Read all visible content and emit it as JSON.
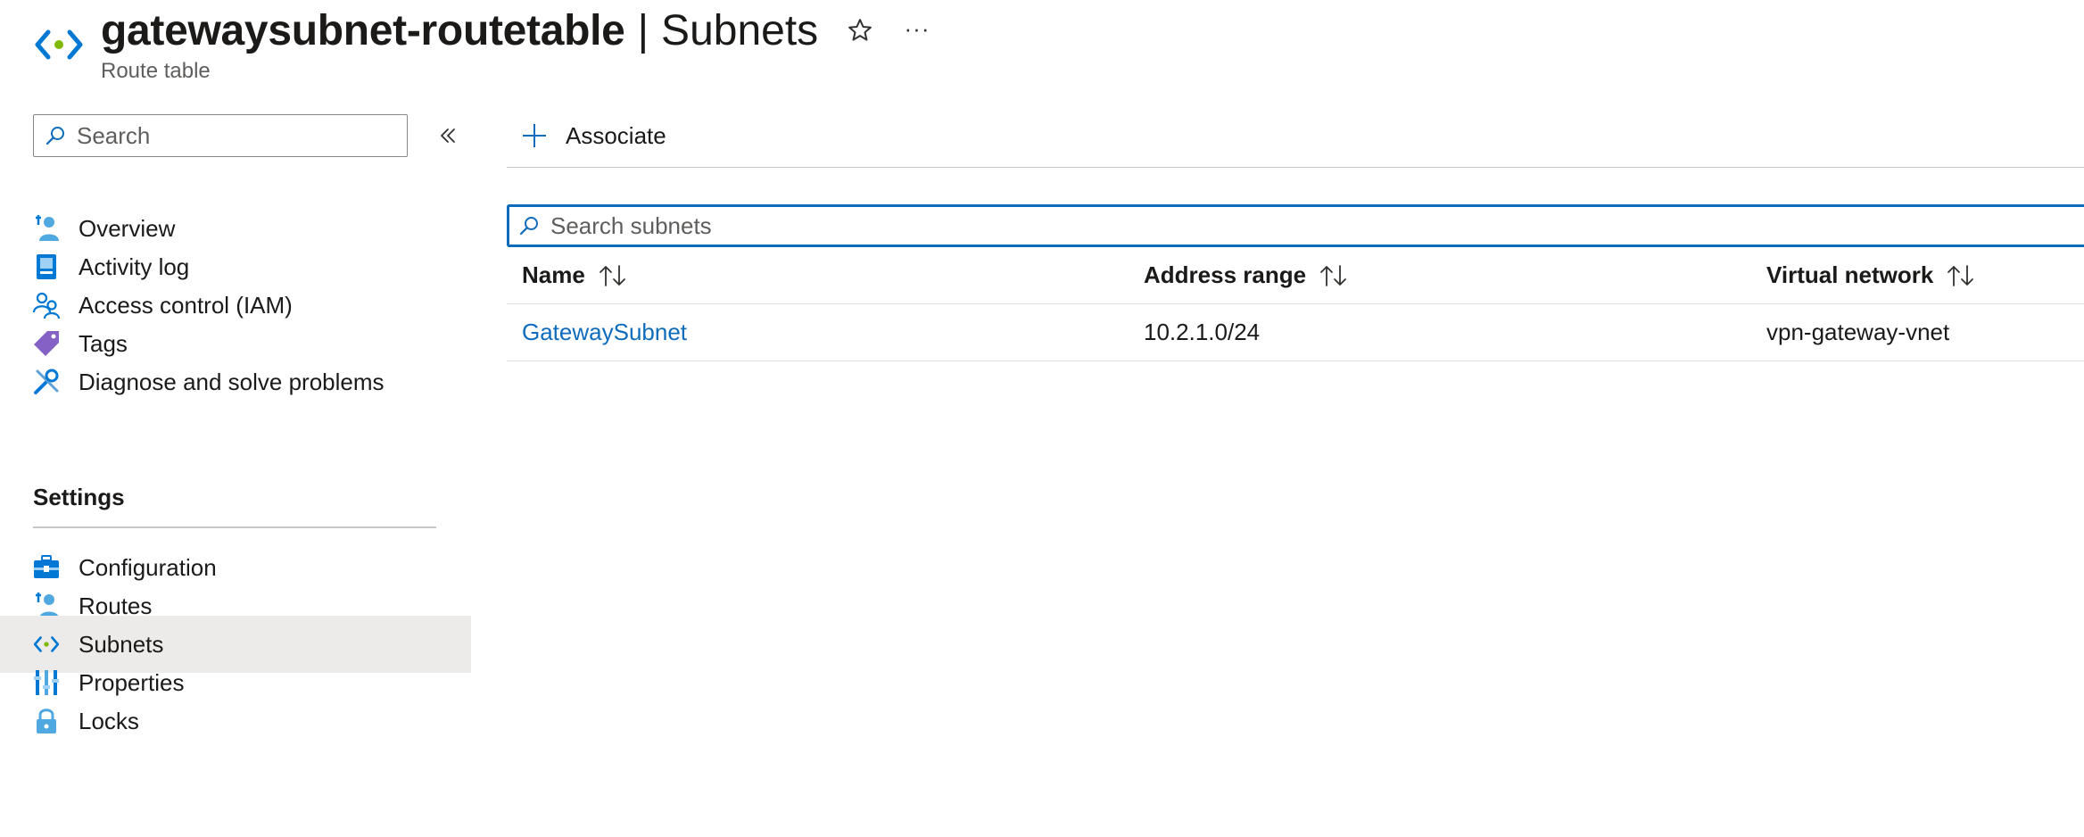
{
  "header": {
    "resource_name": "gatewaysubnet-routetable",
    "separator": "|",
    "page_name": "Subnets",
    "subtitle": "Route table",
    "more_label": "···"
  },
  "sidebar": {
    "search_placeholder": "Search",
    "items": [
      {
        "label": "Overview",
        "icon": "overview-icon"
      },
      {
        "label": "Activity log",
        "icon": "activity-log-icon"
      },
      {
        "label": "Access control (IAM)",
        "icon": "iam-icon"
      },
      {
        "label": "Tags",
        "icon": "tag-icon"
      },
      {
        "label": "Diagnose and solve problems",
        "icon": "wrench-icon"
      }
    ],
    "settings_header": "Settings",
    "settings_items": [
      {
        "label": "Configuration",
        "icon": "configuration-icon"
      },
      {
        "label": "Routes",
        "icon": "routes-icon"
      },
      {
        "label": "Subnets",
        "icon": "subnets-icon",
        "selected": true
      },
      {
        "label": "Properties",
        "icon": "properties-icon"
      },
      {
        "label": "Locks",
        "icon": "lock-icon"
      }
    ]
  },
  "toolbar": {
    "associate_label": "Associate"
  },
  "grid": {
    "search_placeholder": "Search subnets",
    "columns": [
      "Name",
      "Address range",
      "Virtual network"
    ],
    "rows": [
      {
        "name": "GatewaySubnet",
        "address_range": "10.2.1.0/24",
        "virtual_network": "vpn-gateway-vnet"
      }
    ]
  },
  "colors": {
    "accent": "#0f6cbd",
    "selected_bg": "#edebe9",
    "text": "#1b1a19",
    "muted": "#605e5c"
  }
}
